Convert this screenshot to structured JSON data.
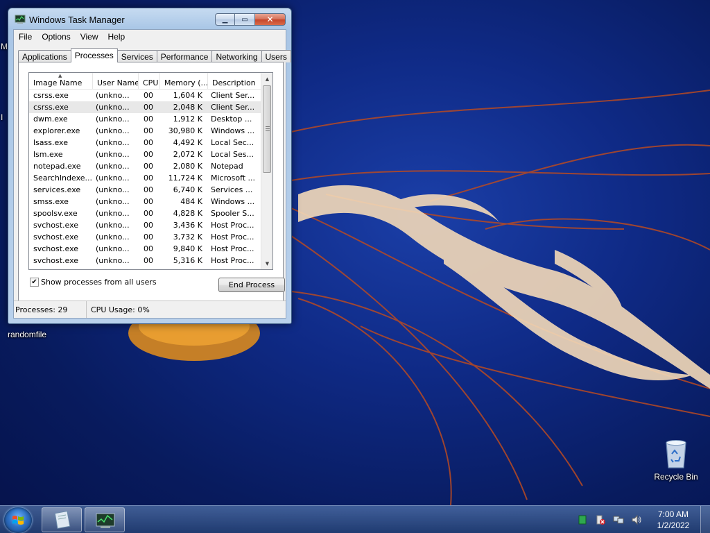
{
  "window": {
    "title": "Windows Task Manager",
    "icon": "task-manager-icon",
    "buttons": {
      "minimize": "minimize-icon",
      "maximize": "maximize-icon",
      "close": "close-icon"
    }
  },
  "menu": [
    "File",
    "Options",
    "View",
    "Help"
  ],
  "tabs": [
    {
      "label": "Applications",
      "active": false
    },
    {
      "label": "Processes",
      "active": true
    },
    {
      "label": "Services",
      "active": false
    },
    {
      "label": "Performance",
      "active": false
    },
    {
      "label": "Networking",
      "active": false
    },
    {
      "label": "Users",
      "active": false
    }
  ],
  "table": {
    "columns": [
      "Image Name",
      "User Name",
      "CPU",
      "Memory (...",
      "Description"
    ],
    "rows": [
      {
        "image": "csrss.exe",
        "user": "(unkno...",
        "cpu": "00",
        "memory": "1,604 K",
        "desc": "Client Ser..."
      },
      {
        "image": "csrss.exe",
        "user": "(unkno...",
        "cpu": "00",
        "memory": "2,048 K",
        "desc": "Client Ser...",
        "selected": true
      },
      {
        "image": "dwm.exe",
        "user": "(unkno...",
        "cpu": "00",
        "memory": "1,912 K",
        "desc": "Desktop ..."
      },
      {
        "image": "explorer.exe",
        "user": "(unkno...",
        "cpu": "00",
        "memory": "30,980 K",
        "desc": "Windows ..."
      },
      {
        "image": "lsass.exe",
        "user": "(unkno...",
        "cpu": "00",
        "memory": "4,492 K",
        "desc": "Local Sec..."
      },
      {
        "image": "lsm.exe",
        "user": "(unkno...",
        "cpu": "00",
        "memory": "2,072 K",
        "desc": "Local Ses..."
      },
      {
        "image": "notepad.exe",
        "user": "(unkno...",
        "cpu": "00",
        "memory": "2,080 K",
        "desc": "Notepad"
      },
      {
        "image": "SearchIndexe...",
        "user": "(unkno...",
        "cpu": "00",
        "memory": "11,724 K",
        "desc": "Microsoft ..."
      },
      {
        "image": "services.exe",
        "user": "(unkno...",
        "cpu": "00",
        "memory": "6,740 K",
        "desc": "Services ..."
      },
      {
        "image": "smss.exe",
        "user": "(unkno...",
        "cpu": "00",
        "memory": "484 K",
        "desc": "Windows ..."
      },
      {
        "image": "spoolsv.exe",
        "user": "(unkno...",
        "cpu": "00",
        "memory": "4,828 K",
        "desc": "Spooler S..."
      },
      {
        "image": "svchost.exe",
        "user": "(unkno...",
        "cpu": "00",
        "memory": "3,436 K",
        "desc": "Host Proc..."
      },
      {
        "image": "svchost.exe",
        "user": "(unkno...",
        "cpu": "00",
        "memory": "3,732 K",
        "desc": "Host Proc..."
      },
      {
        "image": "svchost.exe",
        "user": "(unkno...",
        "cpu": "00",
        "memory": "9,840 K",
        "desc": "Host Proc..."
      },
      {
        "image": "svchost.exe",
        "user": "(unkno...",
        "cpu": "00",
        "memory": "5,316 K",
        "desc": "Host Proc..."
      }
    ]
  },
  "show_all_users": {
    "label": "Show processes from all users",
    "checked": true
  },
  "end_process_label": "End Process",
  "status": {
    "processes": "Processes: 29",
    "cpu": "CPU Usage: 0%"
  },
  "desktop": {
    "partial_labels": [
      "M",
      "I"
    ],
    "file_label": "randomfile",
    "recycle_bin_label": "Recycle Bin"
  },
  "taskbar": {
    "clock_time": "7:00 AM",
    "clock_date": "1/2/2022",
    "tray_icons": [
      "tray-app-icon",
      "action-center-icon",
      "network-icon",
      "volume-icon"
    ]
  },
  "colors": {
    "desktop": "#0f2a86",
    "selection": "#e8e8e8"
  }
}
